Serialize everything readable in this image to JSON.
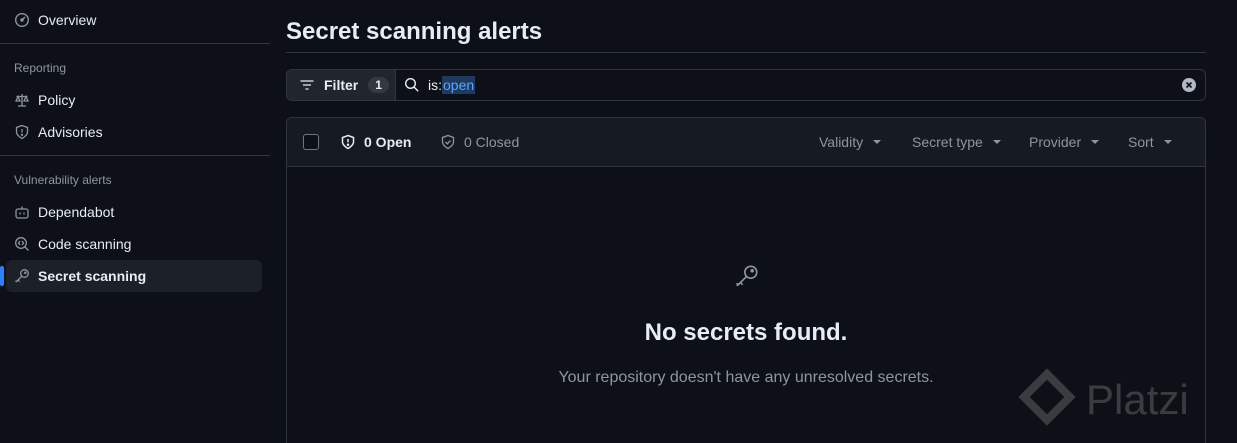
{
  "sidebar": {
    "overview": "Overview",
    "reporting_heading": "Reporting",
    "policy": "Policy",
    "advisories": "Advisories",
    "vuln_heading": "Vulnerability alerts",
    "dependabot": "Dependabot",
    "code_scanning": "Code scanning",
    "secret_scanning": "Secret scanning",
    "active_item": "Secret scanning"
  },
  "main": {
    "title": "Secret scanning alerts",
    "filter": {
      "label": "Filter",
      "count": "1",
      "query_prefix": "is:",
      "query_value": "open"
    },
    "states": {
      "open": "0 Open",
      "closed": "0 Closed"
    },
    "dropdowns": {
      "validity": "Validity",
      "secret_type": "Secret type",
      "provider": "Provider",
      "sort": "Sort"
    },
    "blankslate": {
      "title": "No secrets found.",
      "text": "Your repository doesn't have any unresolved secrets."
    }
  },
  "watermark": "Platzi",
  "colors": {
    "background": "#0d1117",
    "accent": "#2f81f7",
    "border": "#30363d",
    "muted_text": "#8d96a0"
  }
}
